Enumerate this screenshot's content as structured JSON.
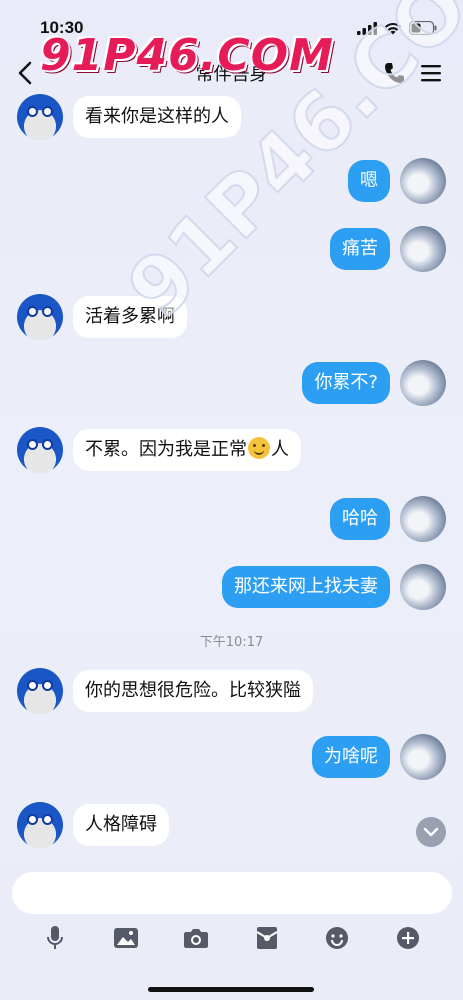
{
  "status": {
    "time": "10:30"
  },
  "header": {
    "title": "常伴吾身"
  },
  "watermark": {
    "text": "91P46.COM"
  },
  "messages": [
    {
      "side": "left",
      "text": "看来你是这样的人"
    },
    {
      "side": "right",
      "text": "嗯"
    },
    {
      "side": "right",
      "text": "痛苦"
    },
    {
      "side": "left",
      "text": "活着多累啊"
    },
    {
      "side": "right",
      "text": "你累不?"
    },
    {
      "side": "left",
      "text_before": "不累。因为我是正常",
      "emoji": "smile-emoji",
      "text_after": "人"
    },
    {
      "side": "right",
      "text": "哈哈"
    },
    {
      "side": "right",
      "text": "那还来网上找夫妻"
    },
    {
      "side": "left",
      "text": "你的思想很危险。比较狭隘"
    },
    {
      "side": "right",
      "text": "为啥呢"
    },
    {
      "side": "left",
      "text": "人格障碍"
    }
  ],
  "timestamp": "下午10:17",
  "toolbar": {
    "icons": [
      "microphone-icon",
      "image-icon",
      "camera-icon",
      "red-packet-icon",
      "emoji-icon",
      "plus-icon"
    ]
  },
  "colors": {
    "outgoing_bubble": "#2d9ff2",
    "incoming_bubble": "#ffffff",
    "background": "#eaedf8"
  }
}
